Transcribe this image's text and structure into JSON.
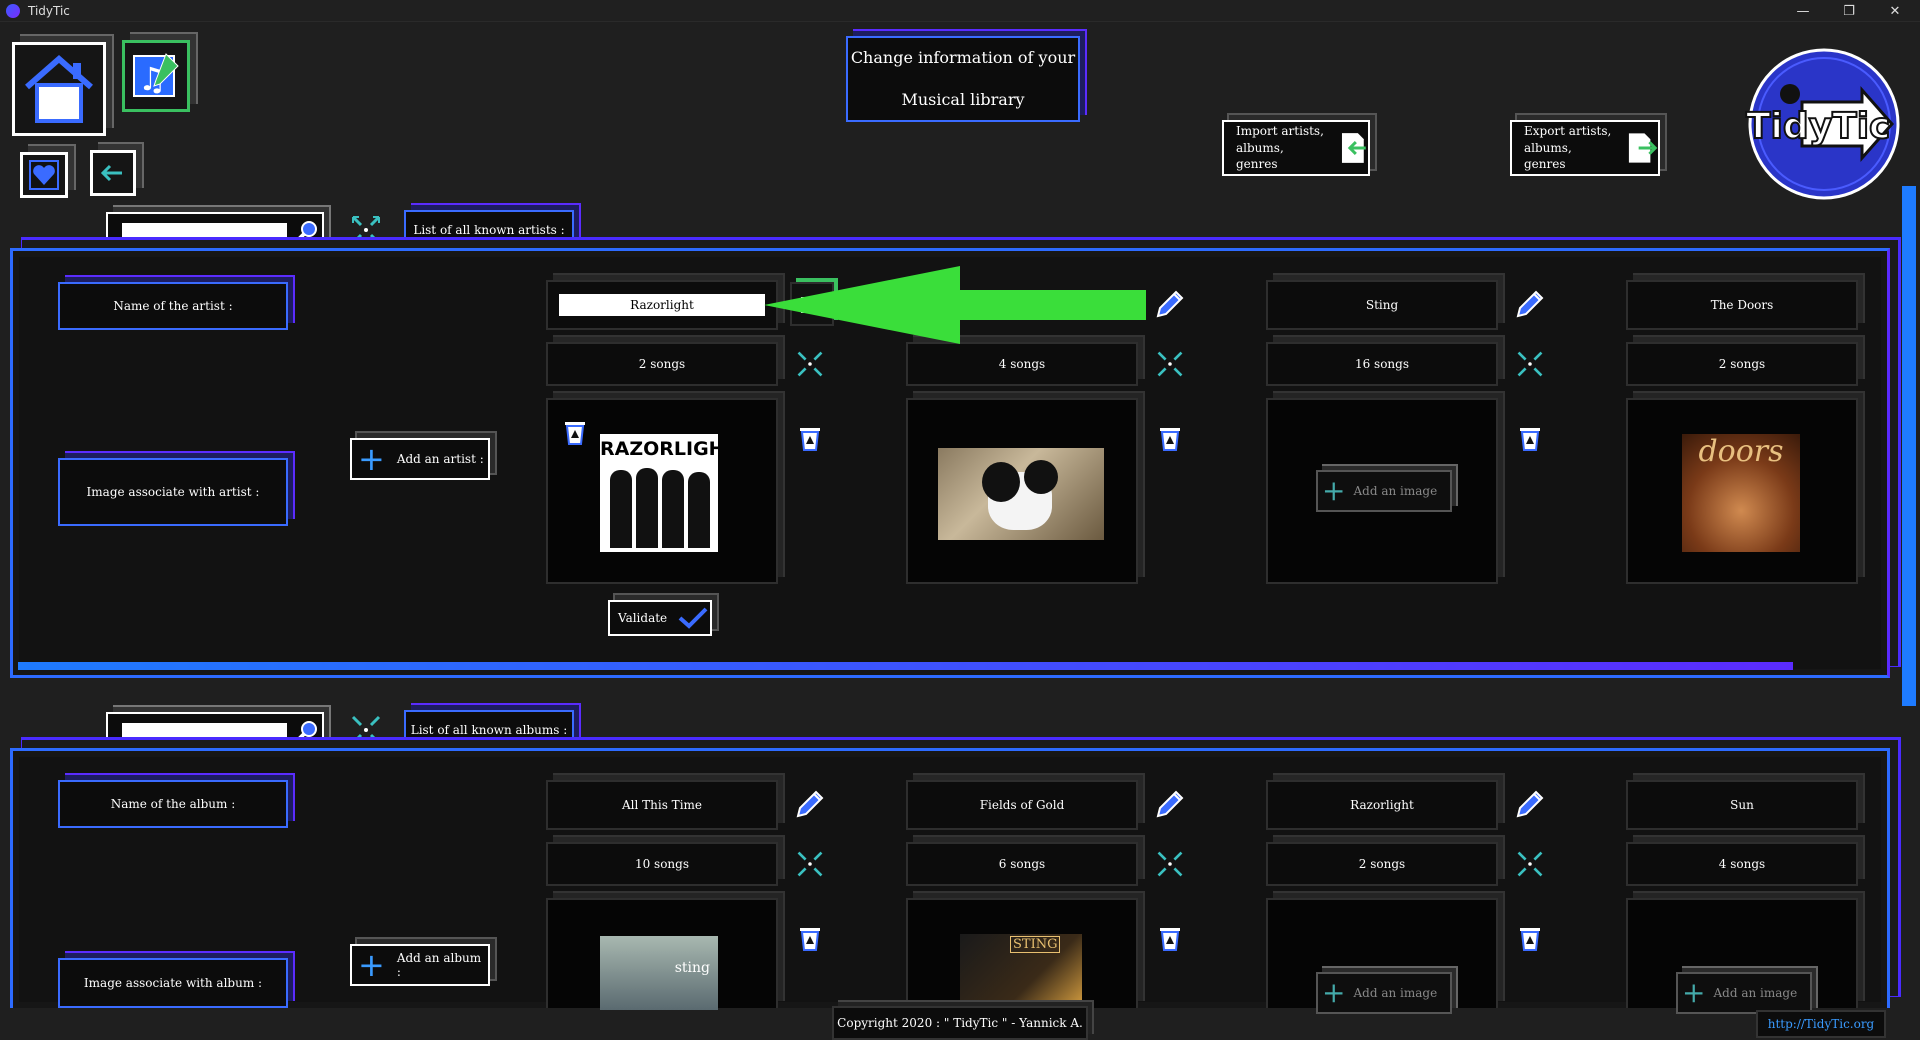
{
  "window": {
    "title": "TidyTic",
    "controls": [
      "—",
      "❐",
      "✕"
    ]
  },
  "header": {
    "title_line1": "Change information of your",
    "title_line2": "Musical library",
    "import_label_1": "Import artists,",
    "import_label_2": "albums, genres",
    "export_label_1": "Export artists,",
    "export_label_2": "albums, genres",
    "logo_text": "TidyTic"
  },
  "artists": {
    "search_placeholder": "",
    "list_title": "List of all known artists :",
    "name_label": "Name of the artist :",
    "image_label": "Image associate with artist :",
    "add_button": "Add an artist :",
    "validate": "Validate",
    "items": [
      {
        "name": "Razorlight",
        "songs": "2 songs",
        "image": "band",
        "editing": true
      },
      {
        "name": "",
        "songs": "4 songs",
        "image": "dog",
        "editing": false
      },
      {
        "name": "Sting",
        "songs": "16 songs",
        "image": "none",
        "editing": false
      },
      {
        "name": "The Doors",
        "songs": "2 songs",
        "image": "doors",
        "editing": false
      }
    ],
    "cover_text_razorlight": "RAZORLIGHT",
    "cover_text_doors": "doors"
  },
  "albums": {
    "search_placeholder": "",
    "list_title": "List of all known albums :",
    "name_label": "Name of the album :",
    "image_label": "Image associate with album :",
    "add_button": "Add an album :",
    "items": [
      {
        "name": "All This Time",
        "songs": "10 songs",
        "image": "sting1"
      },
      {
        "name": "Fields of Gold",
        "songs": "6 songs",
        "image": "sting2"
      },
      {
        "name": "Razorlight",
        "songs": "2 songs",
        "image": "none"
      },
      {
        "name": "Sun",
        "songs": "4 songs",
        "image": "none"
      }
    ],
    "cover_text_sting1": "sting",
    "cover_text_sting2": "STING"
  },
  "add_image_label": "Add an image",
  "footer": {
    "copyright": "Copyright 2020 : \" TidyTic \" - Yannick A.",
    "link": "http://TidyTic.org"
  }
}
